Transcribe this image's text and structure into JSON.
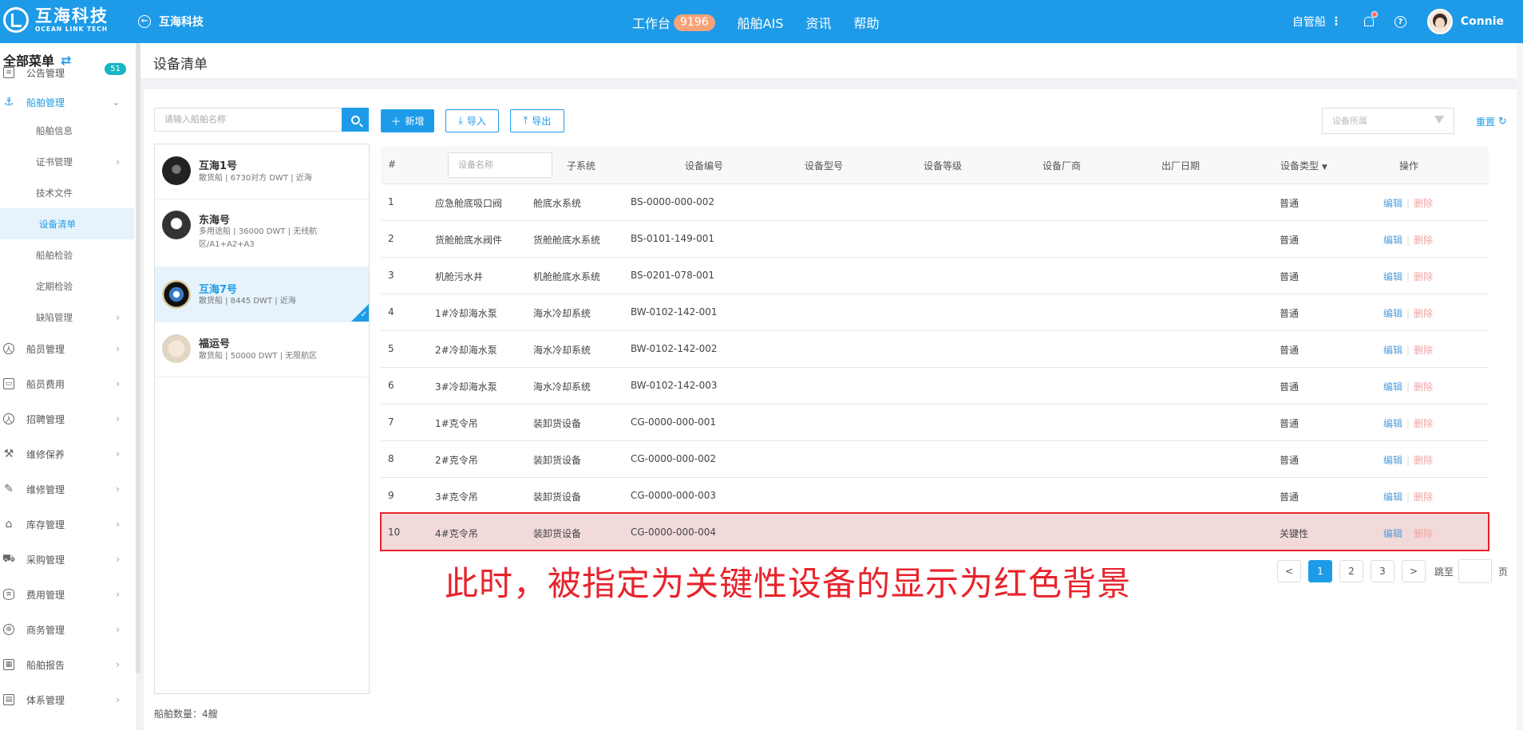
{
  "header": {
    "logo_cn": "互海科技",
    "logo_en": "OCEAN LINK TECH",
    "back_label": "互海科技",
    "nav": [
      {
        "label": "工作台",
        "badge": "9196"
      },
      {
        "label": "船舶AIS"
      },
      {
        "label": "资讯"
      },
      {
        "label": "帮助"
      }
    ],
    "self_managed": "自管船",
    "user": "Connie"
  },
  "sidebar": {
    "title": "全部菜单",
    "items": [
      {
        "label": "公告管理",
        "badge": "51",
        "icon": "book-icon"
      },
      {
        "label": "船舶管理",
        "icon": "anchor-icon",
        "active": true
      },
      {
        "label": "船舶信息"
      },
      {
        "label": "证书管理"
      },
      {
        "label": "技术文件"
      },
      {
        "label": "设备清单",
        "active": true
      },
      {
        "label": "船舶检验"
      },
      {
        "label": "定期检验"
      },
      {
        "label": "缺陷管理"
      },
      {
        "label": "船员管理",
        "icon": "person-icon"
      },
      {
        "label": "船员费用",
        "icon": "wallet-icon"
      },
      {
        "label": "招聘管理",
        "icon": "recruit-icon"
      },
      {
        "label": "维修保养",
        "icon": "tool-icon"
      },
      {
        "label": "维修管理",
        "icon": "wrench-icon"
      },
      {
        "label": "库存管理",
        "icon": "warehouse-icon"
      },
      {
        "label": "采购管理",
        "icon": "cart-icon"
      },
      {
        "label": "费用管理",
        "icon": "database-icon"
      },
      {
        "label": "商务管理",
        "icon": "globe-icon"
      },
      {
        "label": "船舶报告",
        "icon": "calendar-icon"
      },
      {
        "label": "体系管理",
        "icon": "doc-icon"
      }
    ]
  },
  "page": {
    "title": "设备清单"
  },
  "ship_panel": {
    "search_placeholder": "请输入船舶名称",
    "ships": [
      {
        "name": "互海1号",
        "desc": "散货船 | 6730对方 DWT | 近海"
      },
      {
        "name": "东海号",
        "desc": "多用途船 | 36000 DWT | 无线航区/A1+A2+A3"
      },
      {
        "name": "互海7号",
        "desc": "散货船 | 8445 DWT | 近海",
        "selected": true
      },
      {
        "name": "福运号",
        "desc": "散货船 | 50000 DWT | 无限航区"
      }
    ],
    "count": "船舶数量：4艘"
  },
  "toolbar": {
    "add": "新增",
    "import": "导入",
    "export": "导出",
    "filter_placeholder": "设备所属",
    "reset": "重置"
  },
  "table": {
    "headers": [
      "#",
      "设备名称",
      "子系统",
      "设备编号",
      "设备型号",
      "设备等级",
      "设备厂商",
      "出厂日期",
      "设备类型",
      "操作"
    ],
    "edit_label": "编辑",
    "delete_label": "删除",
    "rows": [
      {
        "no": "1",
        "name": "应急舱底吸口阀",
        "subsystem": "舱底水系统",
        "code": "BS-0000-000-002",
        "type": "普通"
      },
      {
        "no": "2",
        "name": "货舱舱底水阀件",
        "subsystem": "货舱舱底水系统",
        "code": "BS-0101-149-001",
        "type": "普通"
      },
      {
        "no": "3",
        "name": "机舱污水井",
        "subsystem": "机舱舱底水系统",
        "code": "BS-0201-078-001",
        "type": "普通"
      },
      {
        "no": "4",
        "name": "1#冷却海水泵",
        "subsystem": "海水冷却系统",
        "code": "BW-0102-142-001",
        "type": "普通"
      },
      {
        "no": "5",
        "name": "2#冷却海水泵",
        "subsystem": "海水冷却系统",
        "code": "BW-0102-142-002",
        "type": "普通"
      },
      {
        "no": "6",
        "name": "3#冷却海水泵",
        "subsystem": "海水冷却系统",
        "code": "BW-0102-142-003",
        "type": "普通"
      },
      {
        "no": "7",
        "name": "1#克令吊",
        "subsystem": "装卸货设备",
        "code": "CG-0000-000-001",
        "type": "普通"
      },
      {
        "no": "8",
        "name": "2#克令吊",
        "subsystem": "装卸货设备",
        "code": "CG-0000-000-002",
        "type": "普通"
      },
      {
        "no": "9",
        "name": "3#克令吊",
        "subsystem": "装卸货设备",
        "code": "CG-0000-000-003",
        "type": "普通"
      },
      {
        "no": "10",
        "name": "4#克令吊",
        "subsystem": "装卸货设备",
        "code": "CG-0000-000-004",
        "type": "关键性",
        "critical": true
      }
    ]
  },
  "annotation": "此时，被指定为关键性设备的显示为红色背景",
  "pagination": {
    "prev": "<",
    "pages": [
      "1",
      "2",
      "3"
    ],
    "current": "1",
    "next": ">",
    "jump_label": "跳至",
    "page_suffix": "页"
  },
  "colors": {
    "primary": "#1e9be8",
    "critical_row": "#f2dadb",
    "highlight": "#e8232c"
  }
}
